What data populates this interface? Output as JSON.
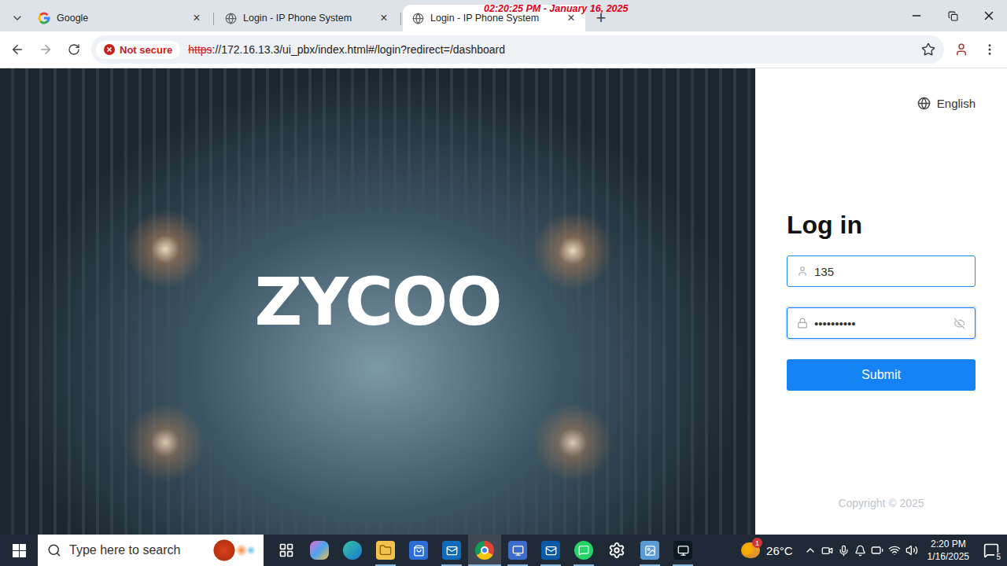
{
  "overlay": {
    "timestamp": "02:20:25 PM - January 16, 2025"
  },
  "tabs": [
    {
      "label": "Google",
      "kind": "google",
      "selected": false,
      "close": "×"
    },
    {
      "label": "Login - IP Phone System",
      "kind": "globe",
      "selected": false,
      "close": "×"
    },
    {
      "label": "Login - IP Phone System",
      "kind": "globe",
      "selected": true,
      "close": "×"
    }
  ],
  "new_tab": "+",
  "address_bar": {
    "security": "Not secure",
    "scheme": "https",
    "rest": "://172.16.13.3/ui_pbx/index.html#/login?redirect=/dashboard",
    "bookmarked": false
  },
  "hero": {
    "logo": "ZYCOO"
  },
  "login": {
    "language": "English",
    "title": "Log in",
    "username": "135",
    "password": "••••••••••",
    "submit": "Submit",
    "copyright": "Copyright © 2025"
  },
  "taskbar": {
    "search_placeholder": "Type here to search",
    "apps": [
      {
        "running": false,
        "selected": false
      },
      {
        "running": false,
        "selected": false
      },
      {
        "running": false,
        "selected": false
      },
      {
        "running": true,
        "selected": false
      },
      {
        "running": false,
        "selected": false
      },
      {
        "running": true,
        "selected": false
      },
      {
        "running": true,
        "selected": true
      },
      {
        "running": true,
        "selected": false
      },
      {
        "running": true,
        "selected": false
      },
      {
        "running": true,
        "selected": false
      },
      {
        "running": false,
        "selected": false
      },
      {
        "running": true,
        "selected": false
      },
      {
        "running": true,
        "selected": false
      }
    ],
    "weather": {
      "temp": "26°C",
      "badge": "1"
    },
    "time": "2:20 PM",
    "date": "1/16/2025",
    "notifications": "5"
  }
}
